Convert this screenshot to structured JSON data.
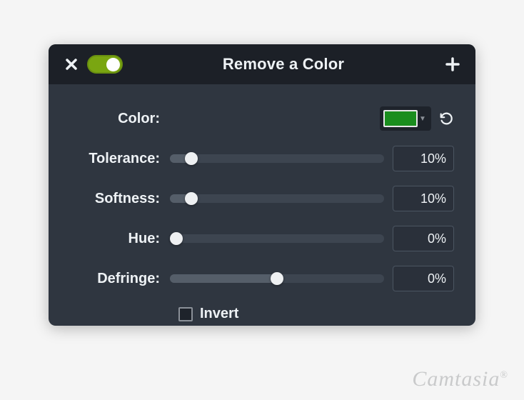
{
  "header": {
    "title": "Remove a Color"
  },
  "color": {
    "label": "Color:",
    "swatch_hex": "#1a8d1e"
  },
  "sliders": {
    "tolerance": {
      "label": "Tolerance:",
      "value": "10%",
      "pos": 10
    },
    "softness": {
      "label": "Softness:",
      "value": "10%",
      "pos": 10
    },
    "hue": {
      "label": "Hue:",
      "value": "0%",
      "pos": 0
    },
    "defringe": {
      "label": "Defringe:",
      "value": "0%",
      "pos": 50
    }
  },
  "invert": {
    "label": "Invert",
    "checked": false
  },
  "watermark": "Camtasia"
}
